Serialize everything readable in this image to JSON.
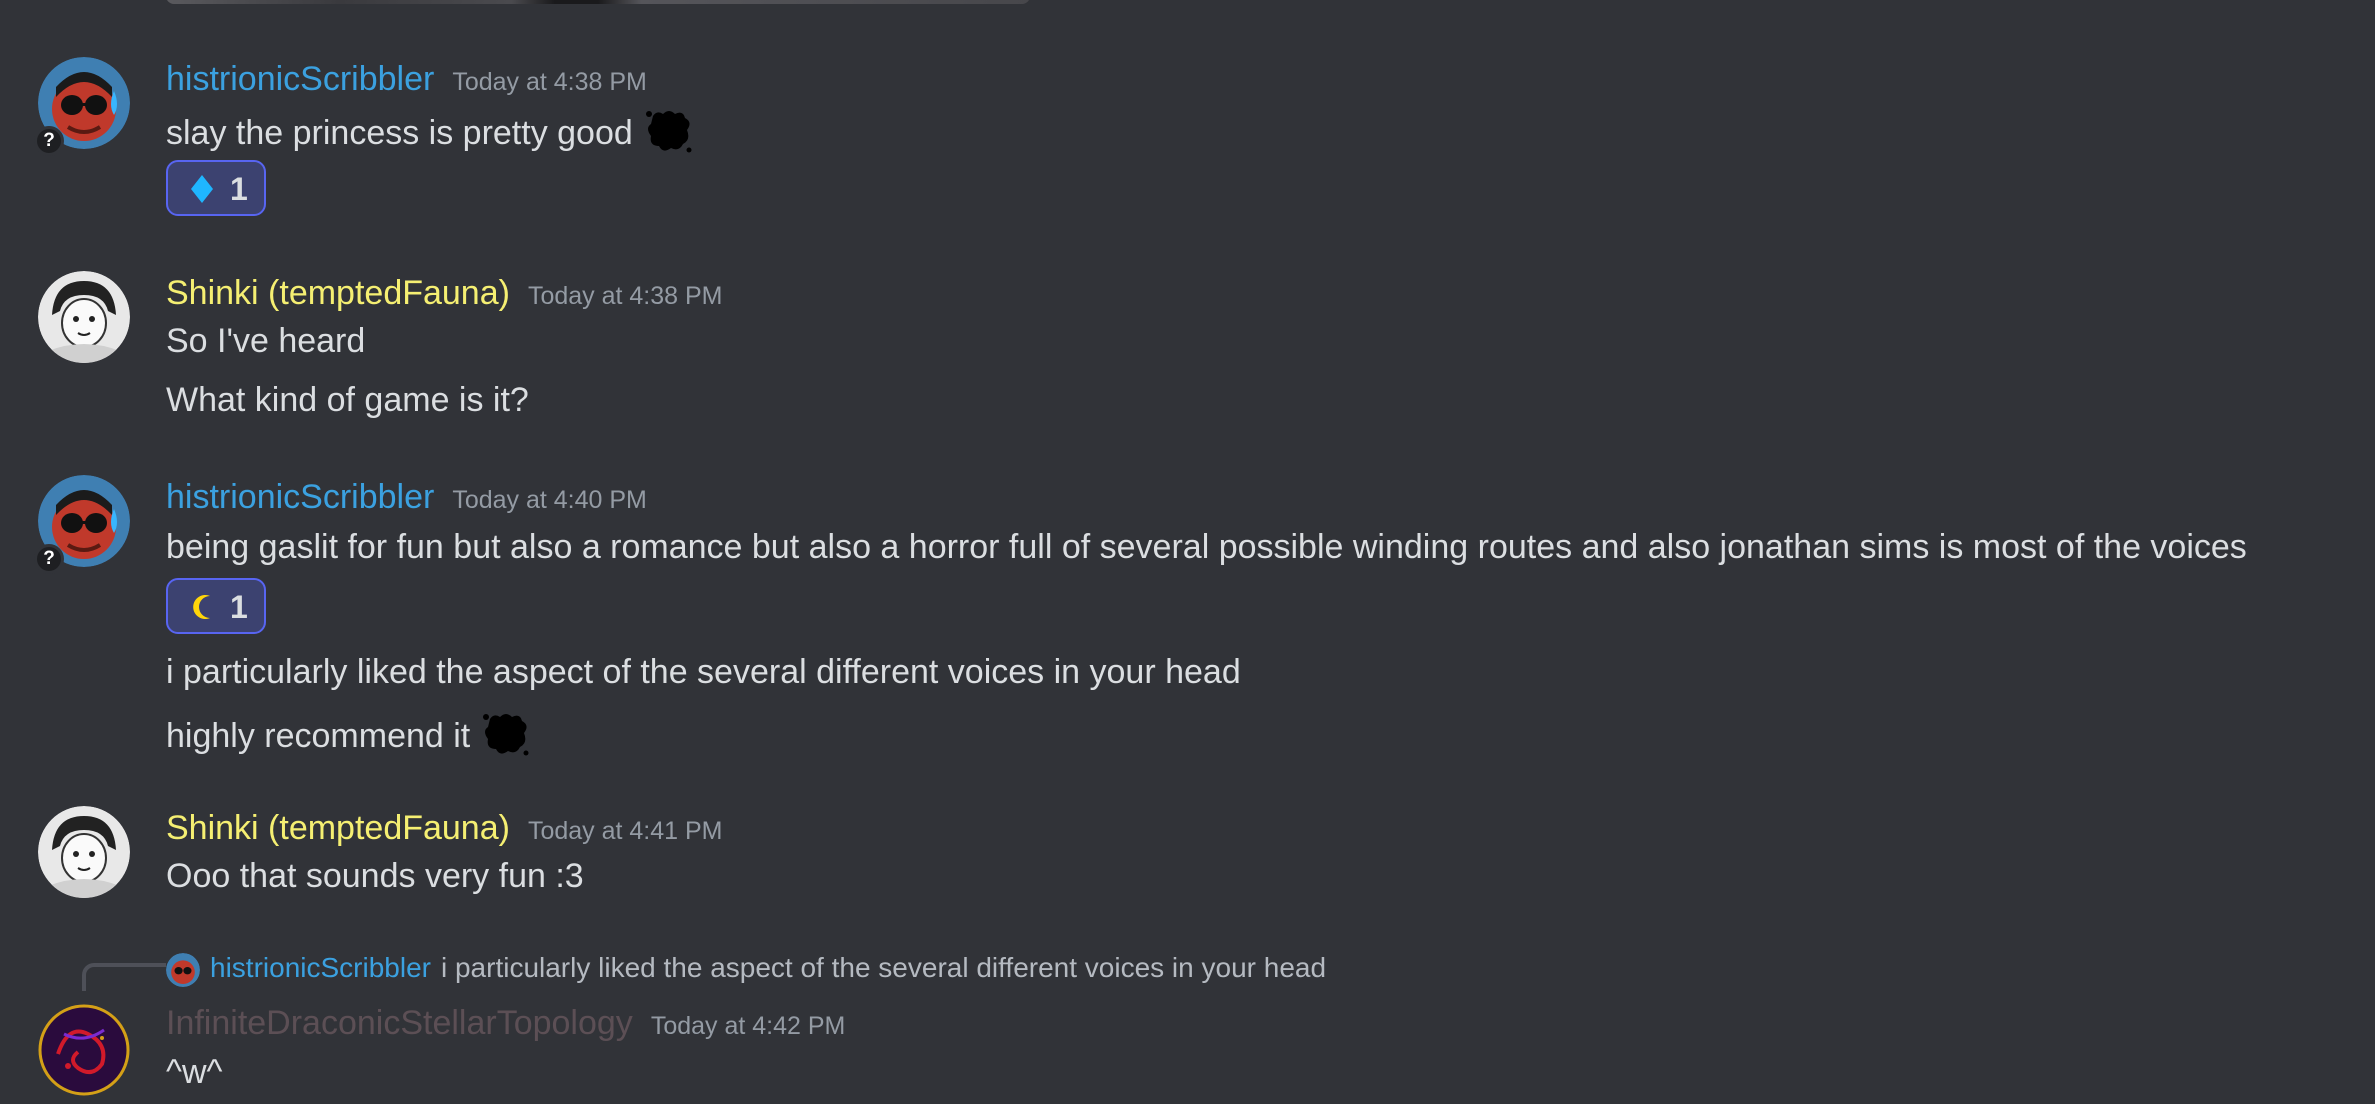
{
  "messages": [
    {
      "username": "histrionicScribbler",
      "timestamp": "Today at 4:38 PM",
      "lines": [
        "slay the princess is pretty good"
      ],
      "reaction": {
        "icon": "blue-diamond-icon",
        "count": "1",
        "color": "#1fb6ff"
      }
    },
    {
      "username": "Shinki (temptedFauna)",
      "timestamp": "Today at 4:38 PM",
      "lines": [
        "So I've heard",
        "What kind of game is it?"
      ]
    },
    {
      "username": "histrionicScribbler",
      "timestamp": "Today at 4:40 PM",
      "lines": [
        "being gaslit for fun but also a romance but also a horror full of several possible winding routes and also jonathan sims is most of the voices",
        "i particularly liked the aspect of the several different voices in your head",
        "highly recommend it"
      ],
      "reaction": {
        "icon": "crescent-moon-icon",
        "count": "1",
        "color": "#ffd60a"
      }
    },
    {
      "username": "Shinki (temptedFauna)",
      "timestamp": "Today at 4:41 PM",
      "lines": [
        "Ooo that sounds very fun :3"
      ]
    },
    {
      "reply_to": {
        "username": "histrionicScribbler",
        "text": "i particularly liked the aspect of the several different voices in your head"
      },
      "username": "InfiniteDraconicStellarTopology",
      "timestamp": "Today at 4:42 PM",
      "lines": [
        "^w^"
      ]
    }
  ],
  "colors": {
    "background": "#313338",
    "text": "#dbdee1",
    "timestamp": "#949ba4",
    "username_blue": "#3ba1e0",
    "username_yellow": "#f5ef72",
    "username_dim": "#5c4f55",
    "reaction_border": "#5865f2"
  }
}
